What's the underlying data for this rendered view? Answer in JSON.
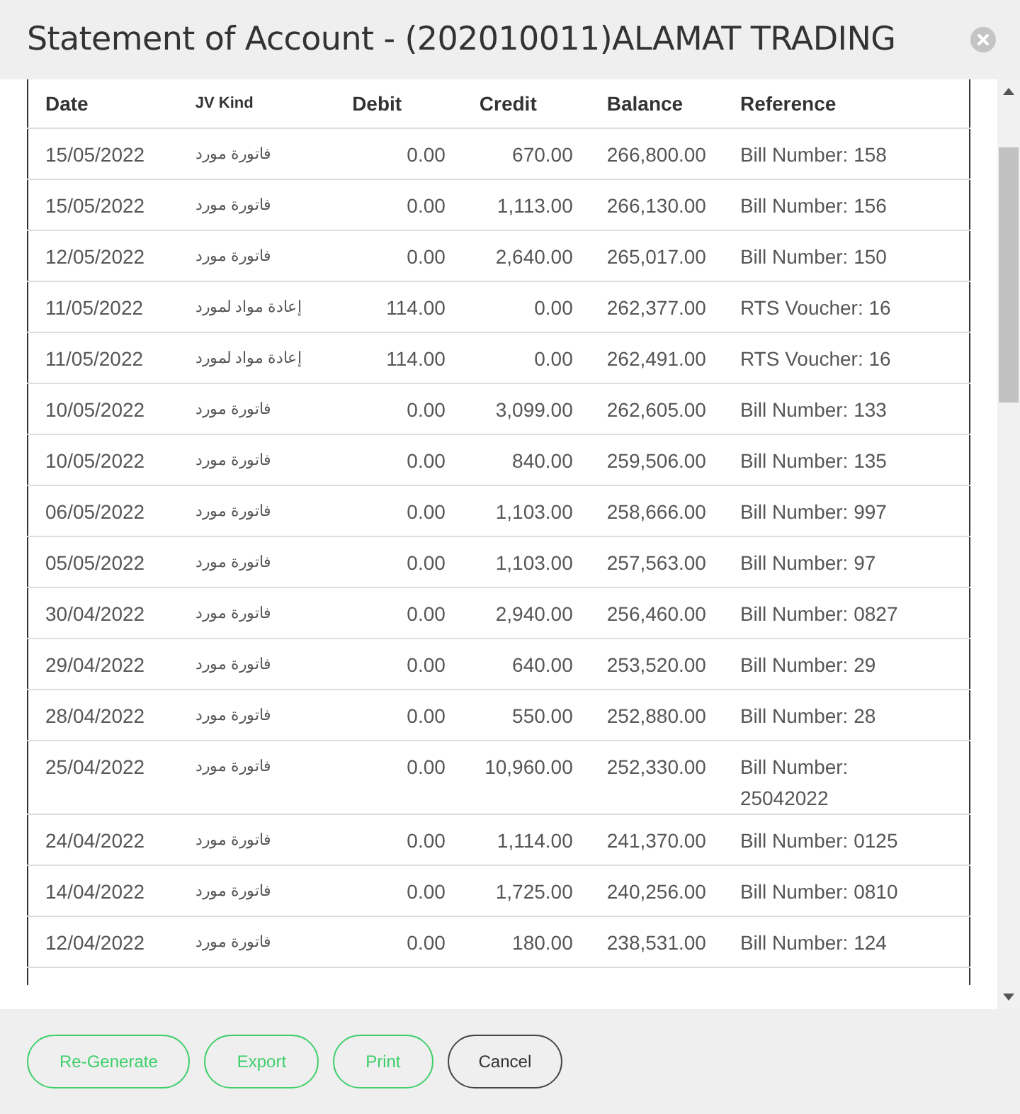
{
  "window": {
    "title": "Statement of Account - (202010011)ALAMAT TRADING"
  },
  "table": {
    "columns": [
      "Date",
      "JV Kind",
      "Debit",
      "Credit",
      "Balance",
      "Reference"
    ],
    "rows": [
      [
        "15/05/2022",
        "فاتورة مورد",
        "0.00",
        "670.00",
        "266,800.00",
        "Bill Number: 158"
      ],
      [
        "15/05/2022",
        "فاتورة مورد",
        "0.00",
        "1,113.00",
        "266,130.00",
        "Bill Number: 156"
      ],
      [
        "12/05/2022",
        "فاتورة مورد",
        "0.00",
        "2,640.00",
        "265,017.00",
        "Bill Number: 150"
      ],
      [
        "11/05/2022",
        "إعادة مواد لمورد",
        "114.00",
        "0.00",
        "262,377.00",
        "RTS Voucher: 16"
      ],
      [
        "11/05/2022",
        "إعادة مواد لمورد",
        "114.00",
        "0.00",
        "262,491.00",
        "RTS Voucher: 16"
      ],
      [
        "10/05/2022",
        "فاتورة مورد",
        "0.00",
        "3,099.00",
        "262,605.00",
        "Bill Number: 133"
      ],
      [
        "10/05/2022",
        "فاتورة مورد",
        "0.00",
        "840.00",
        "259,506.00",
        "Bill Number: 135"
      ],
      [
        "06/05/2022",
        "فاتورة مورد",
        "0.00",
        "1,103.00",
        "258,666.00",
        "Bill Number: 997"
      ],
      [
        "05/05/2022",
        "فاتورة مورد",
        "0.00",
        "1,103.00",
        "257,563.00",
        "Bill Number: 97"
      ],
      [
        "30/04/2022",
        "فاتورة مورد",
        "0.00",
        "2,940.00",
        "256,460.00",
        "Bill Number: 0827"
      ],
      [
        "29/04/2022",
        "فاتورة مورد",
        "0.00",
        "640.00",
        "253,520.00",
        "Bill Number: 29"
      ],
      [
        "28/04/2022",
        "فاتورة مورد",
        "0.00",
        "550.00",
        "252,880.00",
        "Bill Number: 28"
      ],
      [
        "25/04/2022",
        "فاتورة مورد",
        "0.00",
        "10,960.00",
        "252,330.00",
        "Bill Number: 25042022"
      ],
      [
        "24/04/2022",
        "فاتورة مورد",
        "0.00",
        "1,114.00",
        "241,370.00",
        "Bill Number: 0125"
      ],
      [
        "14/04/2022",
        "فاتورة مورد",
        "0.00",
        "1,725.00",
        "240,256.00",
        "Bill Number: 0810"
      ],
      [
        "12/04/2022",
        "فاتورة مورد",
        "0.00",
        "180.00",
        "238,531.00",
        "Bill Number: 124"
      ]
    ]
  },
  "buttons": [
    {
      "label": "Re-Generate",
      "kind": "primary"
    },
    {
      "label": "Export",
      "kind": "primary"
    },
    {
      "label": "Print",
      "kind": "primary"
    },
    {
      "label": "Cancel",
      "kind": "secondary"
    }
  ]
}
